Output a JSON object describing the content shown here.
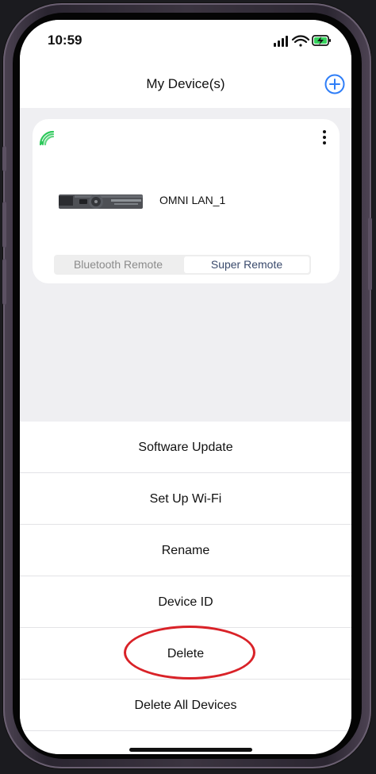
{
  "status_bar": {
    "time": "10:59",
    "icons": [
      "signal-icon",
      "wifi-icon",
      "battery-charging-icon"
    ]
  },
  "header": {
    "title": "My Device(s)",
    "add_icon": "plus-circle-icon"
  },
  "device_card": {
    "connection_icon": "wifi-signal-icon",
    "menu_icon": "more-vertical-icon",
    "device_name": "OMNI LAN_1",
    "segments": [
      {
        "label": "Bluetooth Remote",
        "selected": false
      },
      {
        "label": "Super Remote",
        "selected": true
      }
    ]
  },
  "action_sheet": {
    "items": [
      {
        "label": "Software Update"
      },
      {
        "label": "Set Up Wi-Fi"
      },
      {
        "label": "Rename"
      },
      {
        "label": "Device ID"
      },
      {
        "label": "Delete",
        "highlighted": true
      },
      {
        "label": "Delete All Devices"
      }
    ]
  },
  "colors": {
    "accent": "#2f7ef7",
    "signal_green": "#2dc85a",
    "highlight_red": "#d92228",
    "screen_background": "#efeff2"
  }
}
